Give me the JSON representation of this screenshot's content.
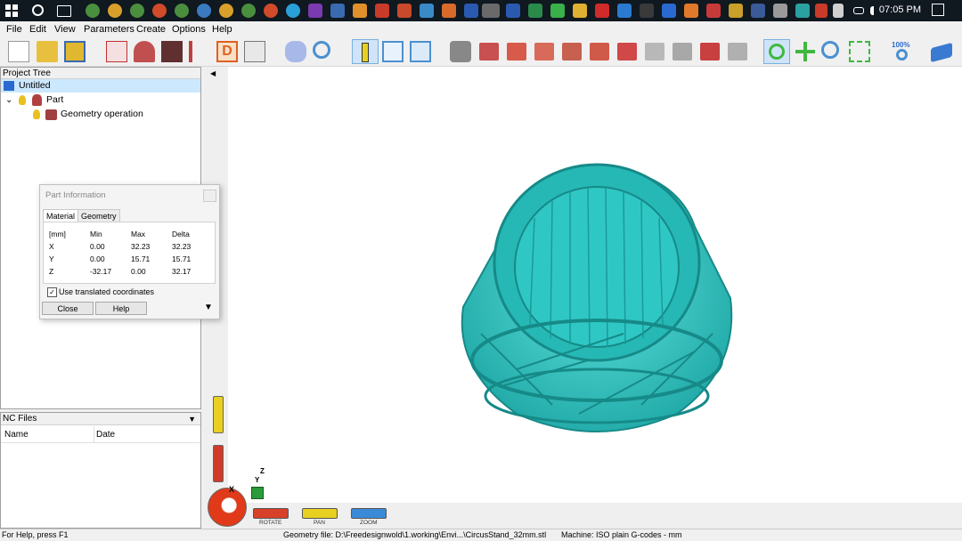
{
  "taskbar": {
    "time": "07:05 PM"
  },
  "menu": [
    "File",
    "Edit",
    "View",
    "Parameters",
    "Create",
    "Options",
    "Help"
  ],
  "toolbar": {
    "zoom_label": "100%"
  },
  "tree": {
    "header": "Project Tree",
    "root": "Untitled",
    "part": "Part",
    "operation": "Geometry operation"
  },
  "nc": {
    "header": "NC Files",
    "columns": [
      "Name",
      "Date"
    ]
  },
  "dialog": {
    "title": "Part Information",
    "tabs": [
      "Material",
      "Geometry"
    ],
    "headers": [
      "[mm]",
      "Min",
      "Max",
      "Delta"
    ],
    "rows": [
      [
        "X",
        "0.00",
        "32.23",
        "32.23"
      ],
      [
        "Y",
        "0.00",
        "15.71",
        "15.71"
      ],
      [
        "Z",
        "-32.17",
        "0.00",
        "32.17"
      ]
    ],
    "checkbox_label": "Use translated coordinates",
    "close": "Close",
    "help": "Help"
  },
  "view_controls": [
    "ROTATE",
    "PAN",
    "ZOOM"
  ],
  "axes": {
    "x": "X",
    "y": "Y",
    "z": "Z"
  },
  "status": {
    "help": "For Help, press F1",
    "file": "Geometry file: D:\\Freedesignwold\\1.working\\Envi...\\CircusStand_32mm.stl",
    "machine": "Machine: ISO plain G-codes - mm"
  },
  "colors": {
    "model": "#2fc7c4",
    "model_dark": "#1a8f8f",
    "selected": "#cce8ff"
  }
}
